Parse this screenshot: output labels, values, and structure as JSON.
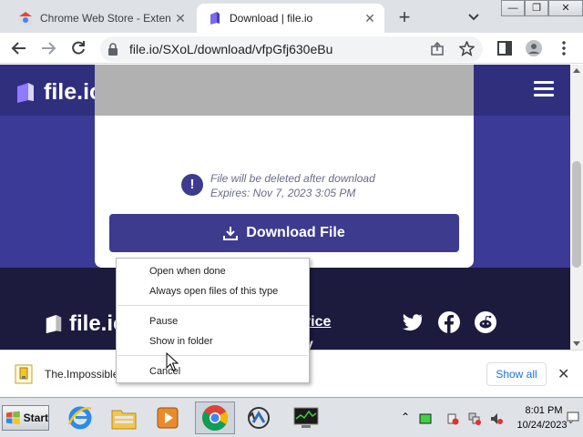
{
  "browser": {
    "tabs": [
      {
        "title": "Chrome Web Store - Extensio",
        "close": "✕"
      },
      {
        "title": "Download | file.io",
        "close": "✕"
      }
    ],
    "new_tab": "+",
    "url": "file.io/SXoL/download/vfpGfj630eBu",
    "window_buttons": [
      "—",
      "❐",
      "✕"
    ]
  },
  "page": {
    "logo_text": "file.io",
    "notice_line1": "File will be deleted after download",
    "notice_line2": "Expires: Nov 7, 2023 3:05 PM",
    "info_glyph": "!",
    "download_button": "Download File",
    "footer": {
      "logo_text": "file.io",
      "link1": "rvice",
      "link2": "cy"
    }
  },
  "context_menu": {
    "items": [
      "Open when done",
      "Always open files of this type",
      "Pause",
      "Show in folder",
      "Cancel"
    ]
  },
  "download_shelf": {
    "filename": "The.Impossible",
    "show_all": "Show all",
    "close": "✕"
  },
  "taskbar": {
    "start": "Start",
    "time": "8:01 PM",
    "date": "10/24/2023"
  },
  "colors": {
    "brand": "#3d3b8e",
    "page_bg": "#3b3a96",
    "footer_bg": "#1c1b3e",
    "chrome_tabstrip": "#dee1e6",
    "link_blue": "#1a73e8"
  }
}
